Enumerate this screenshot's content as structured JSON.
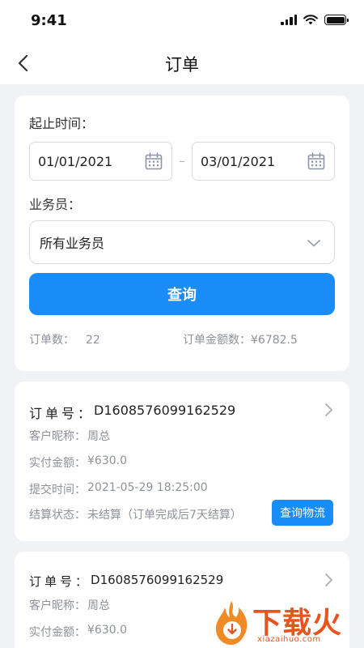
{
  "status_bar": {
    "time": "9:41"
  },
  "nav": {
    "title": "订单"
  },
  "filter": {
    "date_label": "起止时间：",
    "start_date": "01/01/2021",
    "end_date": "03/01/2021",
    "separator": "–",
    "salesperson_label": "业务员：",
    "salesperson_value": "所有业务员",
    "query_button": "查询",
    "order_count_label": "订单数：",
    "order_count": "22",
    "order_amount_label": "订单金额数：",
    "order_amount": "¥6782.5"
  },
  "orders": [
    {
      "no_label": "订单号：",
      "no": "D1608576099162529",
      "customer_label": "客户昵称：",
      "customer": "周总",
      "paid_label": "实付金额：",
      "paid": "¥630.0",
      "submit_label": "提交时间：",
      "submit_time": "2021-05-29 18:25:00",
      "settle_label": "结算状态：",
      "settle_status": "未结算（订单完成后7天结算）",
      "logistics_button": "查询物流"
    },
    {
      "no_label": "订单号：",
      "no": "D1608576099162529",
      "customer_label": "客户昵称：",
      "customer": "周总",
      "paid_label": "实付金额：",
      "paid": "¥630.0"
    }
  ],
  "watermark": {
    "brand": "下载火",
    "domain": "xiazaihuo.com"
  },
  "colors": {
    "accent": "#1a8cf7",
    "background": "#f1f2f5",
    "watermark": "#e8541e"
  }
}
